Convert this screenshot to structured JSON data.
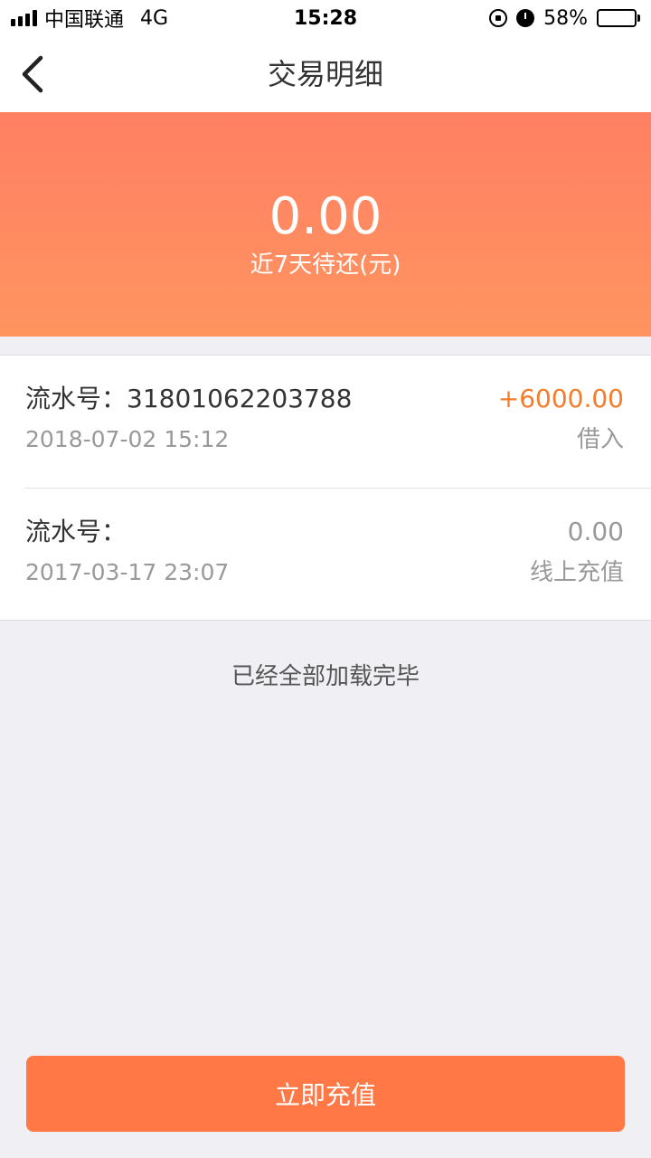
{
  "status_bar": {
    "carrier": "中国联通",
    "network": "4G",
    "time": "15:28",
    "battery_percent": "58%",
    "battery_level": 0.58,
    "signal_bars": 4,
    "icons": [
      "signal-icon",
      "orientation-lock-icon",
      "alarm-icon",
      "battery-icon"
    ]
  },
  "nav": {
    "title": "交易明细",
    "back_icon": "chevron-left-icon"
  },
  "summary": {
    "amount": "0.00",
    "label": "近7天待还(元)"
  },
  "transactions": [
    {
      "serial": "流水号：31801062203788",
      "date": "2018-07-02 15:12",
      "amount": "+6000.00",
      "amount_color": "#f57c2a",
      "type": "借入"
    },
    {
      "serial": "流水号：",
      "date": "2017-03-17 23:07",
      "amount": "0.00",
      "amount_color": "#999999",
      "type": "线上充值"
    }
  ],
  "footer_text": "已经全部加载完毕",
  "recharge_button": "立即充值",
  "colors": {
    "header_gradient_top": "#ff8063",
    "header_gradient_bottom": "#ff9460",
    "button": "#ff7846",
    "background": "#efeff4"
  }
}
